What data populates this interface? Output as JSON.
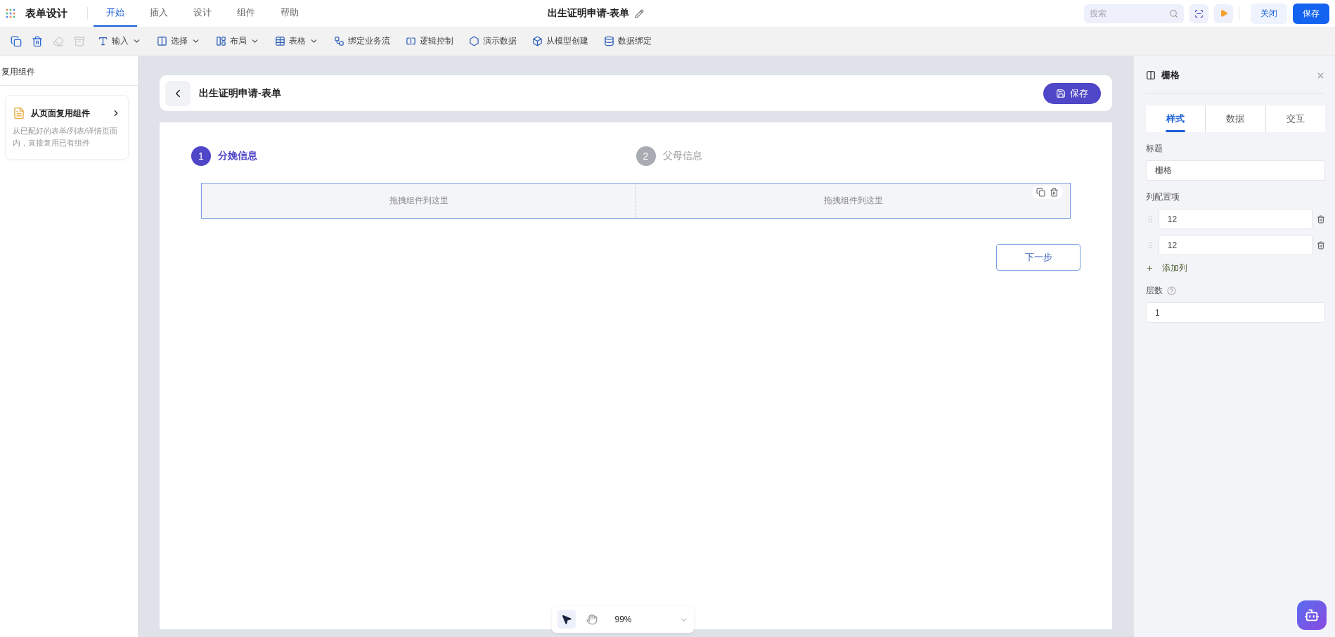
{
  "app": {
    "title": "表单设计",
    "doc_title": "出生证明申请-表单"
  },
  "menu_tabs": [
    {
      "label": "开始",
      "selected": true
    },
    {
      "label": "插入",
      "selected": false
    },
    {
      "label": "设计",
      "selected": false
    },
    {
      "label": "组件",
      "selected": false
    },
    {
      "label": "帮助",
      "selected": false
    }
  ],
  "search": {
    "placeholder": "搜索"
  },
  "top_buttons": [
    {
      "label": "关闭",
      "kind": "secondary"
    },
    {
      "label": "保存",
      "kind": "primary"
    }
  ],
  "toolbar": [
    {
      "kind": "icon",
      "disabled": false
    },
    {
      "kind": "icon",
      "disabled": false
    },
    {
      "kind": "icon",
      "disabled": true
    },
    {
      "kind": "icon",
      "disabled": true
    },
    {
      "kind": "menu",
      "label": "输入"
    },
    {
      "kind": "menu",
      "label": "选择"
    },
    {
      "kind": "menu",
      "label": "布局"
    },
    {
      "kind": "menu",
      "label": "表格"
    },
    {
      "kind": "button",
      "label": "绑定业务流"
    },
    {
      "kind": "button",
      "label": "逻辑控制"
    },
    {
      "kind": "button",
      "label": "演示数据"
    },
    {
      "kind": "button",
      "label": "从模型创建"
    },
    {
      "kind": "button",
      "label": "数据绑定"
    }
  ],
  "left_panel": {
    "title": "复用组件",
    "card": {
      "title": "从页面复用组件",
      "description": "从已配好的表单/列表/详情页面内，直接复用已有组件"
    }
  },
  "form_header": {
    "title": "出生证明申请-表单",
    "save_label": "保存"
  },
  "steps": [
    {
      "number": "1",
      "label": "分娩信息",
      "selected": true
    },
    {
      "number": "2",
      "label": "父母信息",
      "selected": false
    }
  ],
  "grid": {
    "cells": [
      "拖拽组件到这里",
      "拖拽组件到这里"
    ]
  },
  "next_button": "下一步",
  "zoom_bar": {
    "tools": [
      {
        "selected": true
      },
      {
        "selected": false
      }
    ],
    "zoom": "99%"
  },
  "right_panel": {
    "title": "栅格",
    "tabs": [
      {
        "label": "样式",
        "selected": true
      },
      {
        "label": "数据",
        "selected": false
      },
      {
        "label": "交互",
        "selected": false
      }
    ],
    "title_label": "标题",
    "title_value": "栅格",
    "columns_label": "列配置项",
    "columns": [
      "12",
      "12"
    ],
    "add_column": "添加列",
    "layers_label": "层数",
    "layers_value": "1"
  }
}
